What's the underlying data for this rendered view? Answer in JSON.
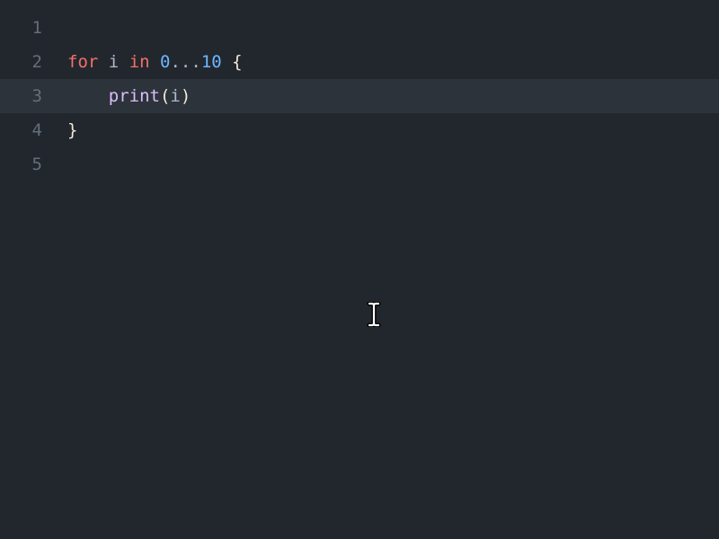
{
  "editor": {
    "lines": [
      {
        "number": "1",
        "highlighted": false
      },
      {
        "number": "2",
        "highlighted": false
      },
      {
        "number": "3",
        "highlighted": true
      },
      {
        "number": "4",
        "highlighted": false
      },
      {
        "number": "5",
        "highlighted": false
      }
    ],
    "code": {
      "line2": {
        "for": "for",
        "space1": " ",
        "var_i": "i",
        "space2": " ",
        "in": "in",
        "space3": " ",
        "num0": "0",
        "range": "...",
        "num10": "10",
        "space4": " ",
        "brace_open": "{"
      },
      "line3": {
        "indent": "    ",
        "print": "print",
        "paren_open": "(",
        "arg": "i",
        "paren_close": ")"
      },
      "line4": {
        "brace_close": "}"
      }
    }
  },
  "colors": {
    "background": "#22272e",
    "highlight_bg": "#2d333b",
    "line_number": "#636e7b",
    "keyword": "#f47067",
    "number": "#6cb6ff",
    "function": "#dcbdfb",
    "brace": "#f0e9d6",
    "default": "#adbac7"
  }
}
